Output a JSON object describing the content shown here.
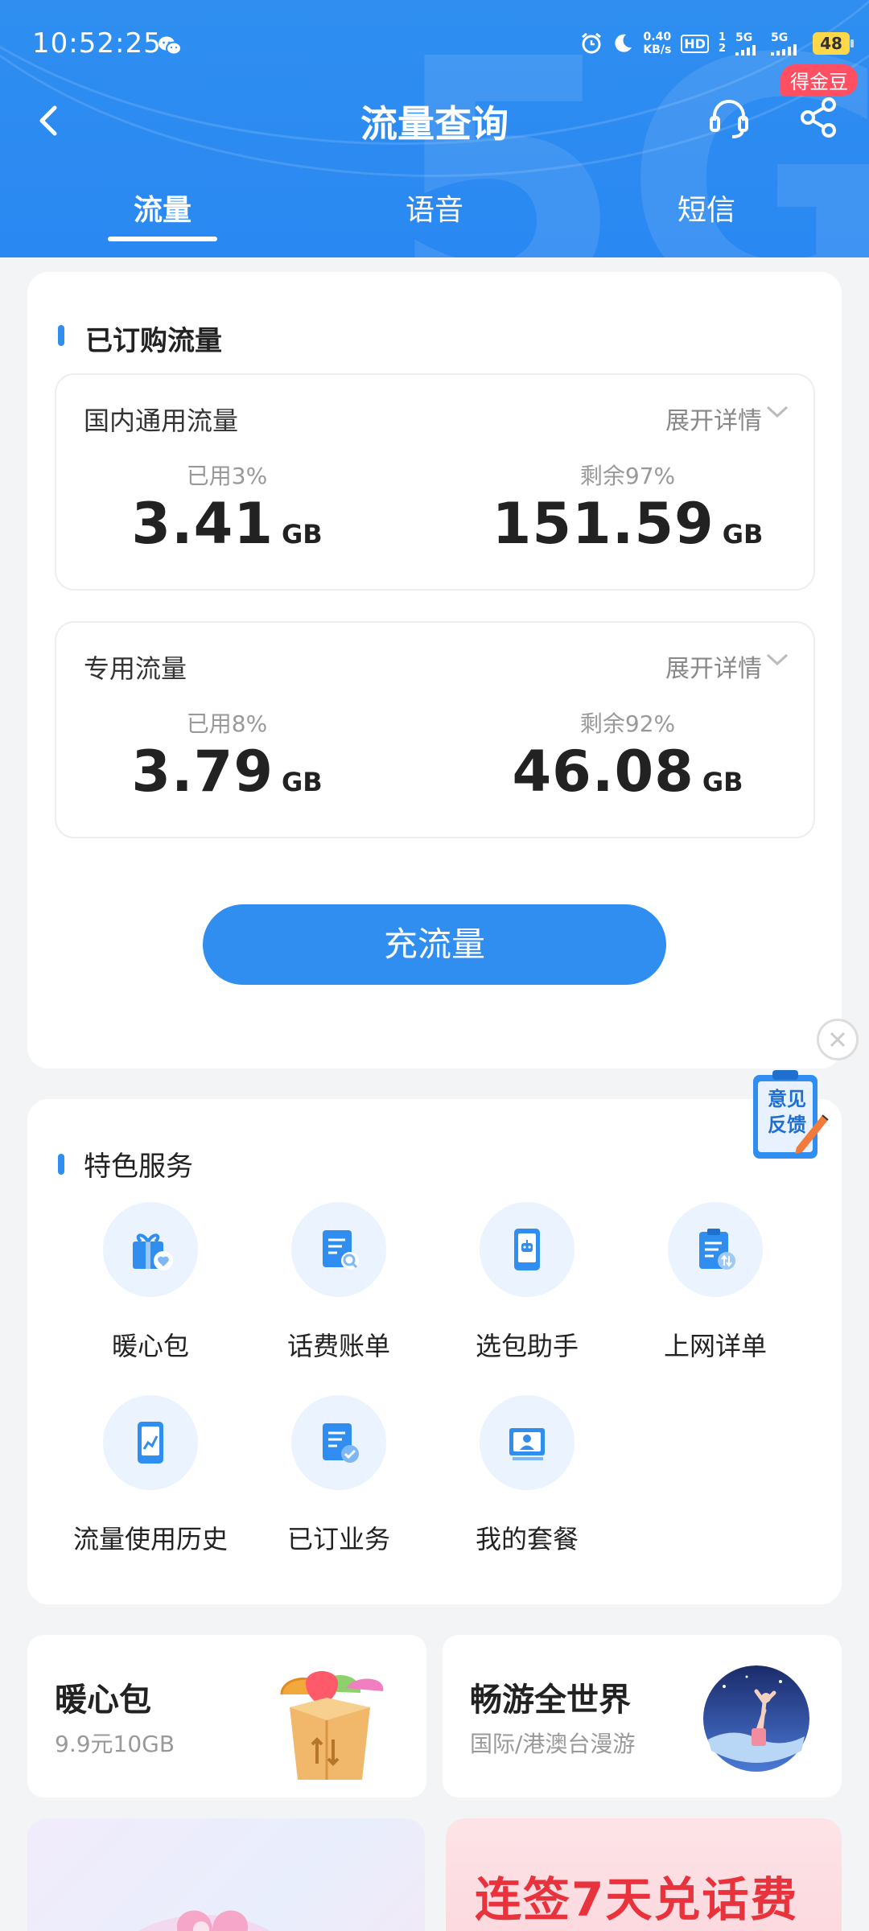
{
  "status_bar": {
    "time": "10:52:25",
    "net_speed_value": "0.40",
    "net_speed_unit": "KB/s",
    "hd": "HD",
    "sim1": "1",
    "sim2": "2",
    "network1": "5G",
    "network2": "5G",
    "battery": "48"
  },
  "header": {
    "title": "流量查询",
    "badge": "得金豆",
    "back_icon": "chevron-left-icon",
    "service_icon": "headset-icon",
    "share_icon": "share-icon"
  },
  "tabs": [
    {
      "label": "流量",
      "active": true
    },
    {
      "label": "语音",
      "active": false
    },
    {
      "label": "短信",
      "active": false
    }
  ],
  "subscribed": {
    "title": "已订购流量",
    "expand_label": "展开详情",
    "items": [
      {
        "name": "国内通用流量",
        "used_label": "已用3%",
        "used_value": "3.41",
        "used_unit": "GB",
        "remaining_label": "剩余97%",
        "remaining_value": "151.59",
        "remaining_unit": "GB"
      },
      {
        "name": "专用流量",
        "used_label": "已用8%",
        "used_value": "3.79",
        "used_unit": "GB",
        "remaining_label": "剩余92%",
        "remaining_value": "46.08",
        "remaining_unit": "GB"
      }
    ],
    "cta": "充流量"
  },
  "feedback": {
    "line1": "意见",
    "line2": "反馈"
  },
  "services": {
    "title": "特色服务",
    "items": [
      {
        "label": "暖心包",
        "icon": "gift-icon"
      },
      {
        "label": "话费账单",
        "icon": "bill-search-icon"
      },
      {
        "label": "选包助手",
        "icon": "phone-robot-icon"
      },
      {
        "label": "上网详单",
        "icon": "clipboard-data-icon"
      },
      {
        "label": "流量使用历史",
        "icon": "phone-chart-icon"
      },
      {
        "label": "已订业务",
        "icon": "document-check-icon"
      },
      {
        "label": "我的套餐",
        "icon": "profile-card-icon"
      }
    ]
  },
  "promos": [
    {
      "title": "暖心包",
      "subtitle": "9.9元10GB",
      "image": "gift-box-icon"
    },
    {
      "title": "畅游全世界",
      "subtitle": "国际/港澳台漫游",
      "image": "travel-globe-icon"
    }
  ],
  "banners": {
    "right_title": "连签7天兑话费"
  },
  "colors": {
    "primary": "#2f8ef0",
    "badge": "#ff4f63",
    "banner_red": "#e8323c"
  }
}
